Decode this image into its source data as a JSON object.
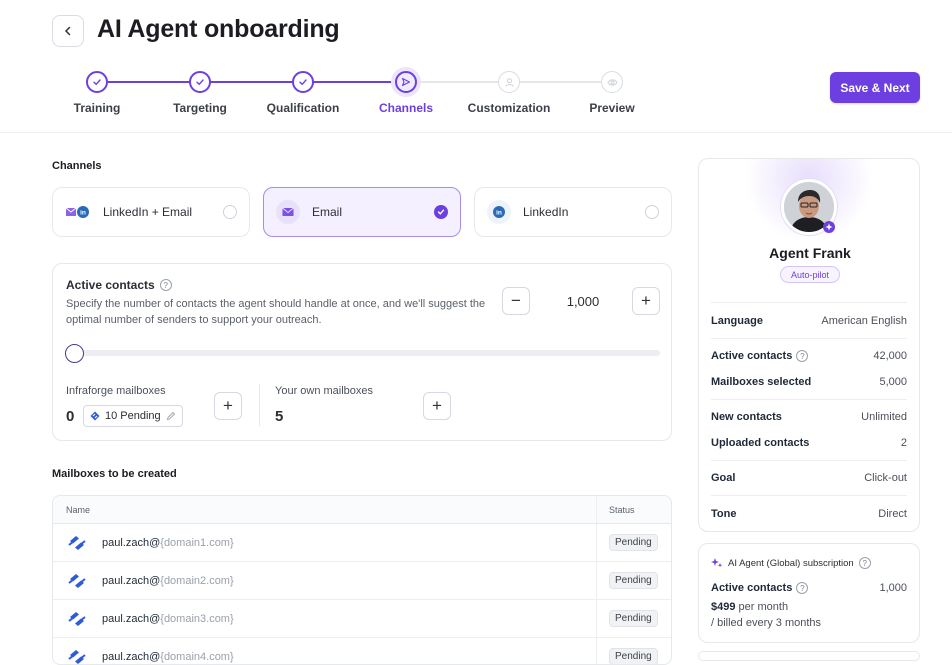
{
  "header": {
    "title": "AI Agent onboarding",
    "save_label": "Save & Next"
  },
  "steps": [
    {
      "label": "Training",
      "state": "done"
    },
    {
      "label": "Targeting",
      "state": "done"
    },
    {
      "label": "Qualification",
      "state": "done"
    },
    {
      "label": "Channels",
      "state": "active"
    },
    {
      "label": "Customization",
      "state": "todo"
    },
    {
      "label": "Preview",
      "state": "todo"
    }
  ],
  "channels": {
    "section_label": "Channels",
    "options": [
      {
        "label": "LinkedIn + Email",
        "selected": false,
        "icon": "linkedin-email-icon"
      },
      {
        "label": "Email",
        "selected": true,
        "icon": "email-icon"
      },
      {
        "label": "LinkedIn",
        "selected": false,
        "icon": "linkedin-icon"
      }
    ]
  },
  "contacts": {
    "title": "Active contacts",
    "description": "Specify the number of contacts the agent should handle at once, and we'll suggest the optimal number of senders to support your outreach.",
    "value": "1,000",
    "slider_fraction": 0,
    "infraforge_label": "Infraforge mailboxes",
    "infraforge_count": "0",
    "pending_label": "10 Pending",
    "own_label": "Your own mailboxes",
    "own_count": "5"
  },
  "mailboxes": {
    "section_label": "Mailboxes to be created",
    "headers": {
      "name": "Name",
      "status": "Status"
    },
    "rows": [
      {
        "user": "paul.zach@",
        "domain": "{domain1.com}",
        "status": "Pending"
      },
      {
        "user": "paul.zach@",
        "domain": "{domain2.com}",
        "status": "Pending"
      },
      {
        "user": "paul.zach@",
        "domain": "{domain3.com}",
        "status": "Pending"
      },
      {
        "user": "paul.zach@",
        "domain": "{domain4.com}",
        "status": "Pending"
      }
    ]
  },
  "agent": {
    "name": "Agent Frank",
    "mode": "Auto-pilot",
    "language_label": "Language",
    "language": "American English",
    "active_contacts_label": "Active contacts",
    "active_contacts": "42,000",
    "mailboxes_label": "Mailboxes selected",
    "mailboxes": "5,000",
    "new_contacts_label": "New contacts",
    "new_contacts": "Unlimited",
    "uploaded_label": "Uploaded contacts",
    "uploaded": "2",
    "goal_label": "Goal",
    "goal": "Click-out",
    "tone_label": "Tone",
    "tone": "Direct"
  },
  "subscription": {
    "title": "AI Agent (Global) subscription",
    "active_label": "Active contacts",
    "active_value": "1,000",
    "price": "$499",
    "per": "per month",
    "billing": "/ billed every 3 months"
  },
  "colors": {
    "accent": "#6d3fe0",
    "linkedin": "#2a6bb8"
  }
}
